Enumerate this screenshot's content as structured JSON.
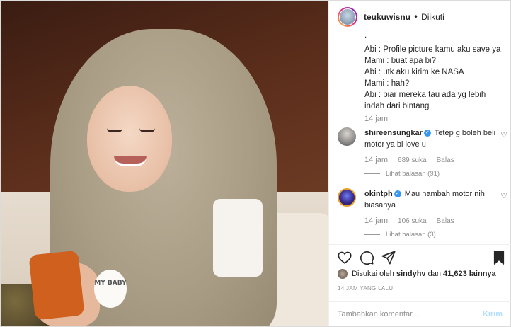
{
  "header": {
    "username": "teukuwisnu",
    "separator": "•",
    "follow_status": "Diikuti"
  },
  "caption": {
    "top_fragment": ".",
    "lines": [
      "Abi : Profile picture kamu aku save ya",
      "Mami : buat apa bi?",
      "Abi : utk aku kirim ke NASA",
      "Mami : hah?",
      "Abi : biar mereka tau ada yg lebih indah dari bintang"
    ],
    "time": "14 jam"
  },
  "comments": [
    {
      "username": "shireensungkar",
      "verified_mark": "✓",
      "text": "Tetep g boleh beli motor ya bi love u",
      "time": "14 jam",
      "likes": "689 suka",
      "reply": "Balas",
      "view_replies": "Lihat balasan (91)"
    },
    {
      "username": "okintph",
      "verified_mark": "✓",
      "text": "Mau nambah motor nih biasanya",
      "time": "14 jam",
      "likes": "106 suka",
      "reply": "Balas",
      "view_replies": "Lihat balasan (3)"
    }
  ],
  "likes_line": {
    "prefix": "Disukai oleh",
    "user": "sindyhv",
    "conj": "dan",
    "count": "41,623 lainnya"
  },
  "post_time": "14 JAM YANG LALU",
  "composer": {
    "placeholder": "Tambahkan komentar...",
    "send_label": "Kirim"
  },
  "photo_badge": "MY BABY",
  "icons": [
    "heart-icon",
    "comment-icon",
    "share-icon",
    "bookmark-icon"
  ],
  "colors": {
    "verified": "#3897f0",
    "muted": "#8e8e8e",
    "send_disabled": "#b2dffc"
  }
}
